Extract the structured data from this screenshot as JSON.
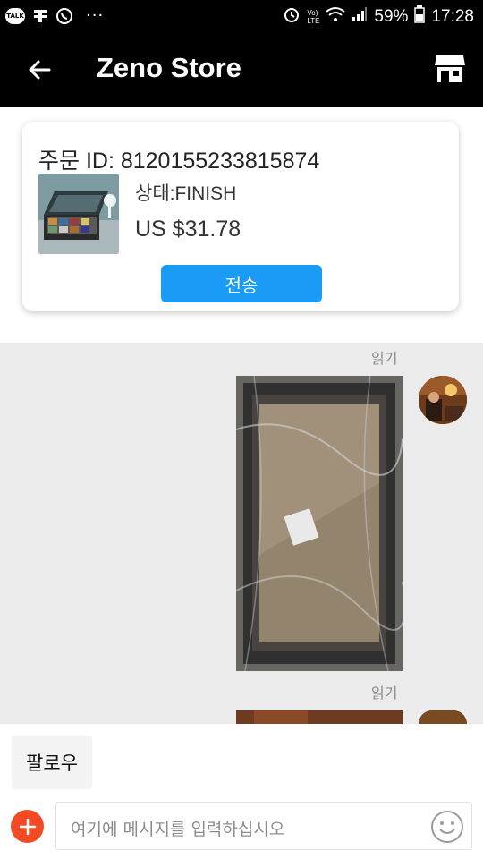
{
  "status_bar": {
    "talk_icon": "talk-icon",
    "battery": "59%",
    "time": "17:28",
    "more": "···",
    "lte_top": "Vo)",
    "lte_bottom": "LTE"
  },
  "header": {
    "title": "Zeno Store",
    "back_icon": "arrow-left-icon",
    "store_icon": "store-icon"
  },
  "order": {
    "id_text": "주문 ID: 8120155233815874",
    "status_text": "상태:FINISH",
    "price": "US $31.78",
    "send_label": "전송"
  },
  "messages": [
    {
      "read_label": "읽기",
      "type": "image"
    },
    {
      "read_label": "읽기",
      "type": "image"
    }
  ],
  "footer": {
    "follow_label": "팔로우",
    "input_placeholder": "여기에 메시지를 입력하십시오"
  },
  "colors": {
    "accent": "#1a9cf6",
    "plus": "#f24a24",
    "chat_bg": "#ebebeb"
  }
}
